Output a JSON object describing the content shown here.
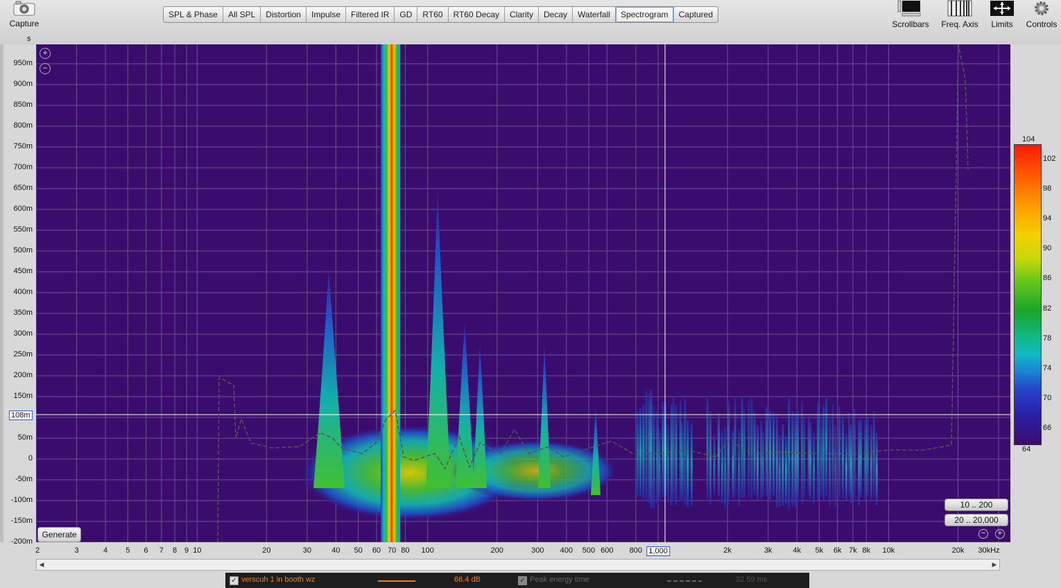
{
  "toolbar": {
    "capture_label": "Capture",
    "tabs": [
      "SPL & Phase",
      "All SPL",
      "Distortion",
      "Impulse",
      "Filtered IR",
      "GD",
      "RT60",
      "RT60 Decay",
      "Clarity",
      "Decay",
      "Waterfall",
      "Spectrogram",
      "Captured"
    ],
    "active_tab": "Spectrogram",
    "tools": [
      "Scrollbars",
      "Freq. Axis",
      "Limits",
      "Controls"
    ]
  },
  "plot": {
    "y_unit": "s",
    "y_ticks": [
      "950m",
      "900m",
      "850m",
      "800m",
      "750m",
      "700m",
      "650m",
      "600m",
      "550m",
      "500m",
      "450m",
      "400m",
      "350m",
      "300m",
      "250m",
      "200m",
      "150m",
      "100m",
      "50m",
      "0",
      "-50m",
      "-100m",
      "-150m",
      "-200m"
    ],
    "x_ticks": [
      "2",
      "3",
      "4",
      "5",
      "6",
      "7",
      "8",
      "9",
      "10",
      "20",
      "30",
      "40",
      "50",
      "60",
      "70",
      "80",
      "100",
      "200",
      "300",
      "400",
      "500",
      "600",
      "800",
      "1,000",
      "2k",
      "3k",
      "4k",
      "5k",
      "6k",
      "7k",
      "8k",
      "10k",
      "20k",
      "30kHz"
    ],
    "x_cursor_label": "1,000",
    "y_cursor_label": "108m",
    "generate_label": "Generate",
    "range_buttons": [
      "10 .. 200",
      "20 .. 20,000"
    ]
  },
  "color_scale": {
    "max": "104",
    "min": "64",
    "ticks": [
      "102",
      "98",
      "94",
      "90",
      "86",
      "82",
      "78",
      "74",
      "70",
      "66"
    ]
  },
  "legend": {
    "trace_name": "verscuh 1 in booth wz",
    "trace_value": "66.4 dB",
    "trace_color": "#f08020",
    "peak_label": "Peak energy time",
    "peak_value": "32.59 ms"
  },
  "chart_data": {
    "type": "heatmap",
    "xlabel": "",
    "ylabel": "s",
    "x_scale": "log",
    "xlim": [
      2,
      30000
    ],
    "ylim": [
      -0.2,
      1.0
    ],
    "color_range": [
      64,
      104
    ],
    "peak_energy_time_ms": 32.59,
    "cursor": {
      "x": 1000,
      "y": 0.108
    },
    "hot_components": [
      {
        "freq": 35,
        "max_time": 0.45
      },
      {
        "freq": 64,
        "max_time": 1.0
      },
      {
        "freq": 100,
        "max_time": 0.65
      },
      {
        "freq": 300,
        "max_time": 0.28
      }
    ]
  }
}
